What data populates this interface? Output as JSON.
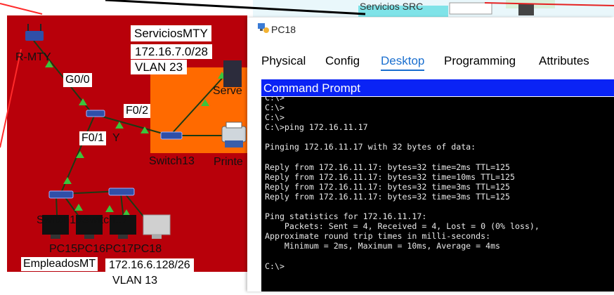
{
  "topology": {
    "labels": {
      "g0_0": "G0/0",
      "f0_2": "F0/2",
      "f0_1": "F0/1",
      "servicios_name": "ServiciosMTY",
      "servicios_net": "172.16.7.0/28",
      "servicios_vlan": "VLAN 23",
      "router": "R-MTY",
      "server": "Serve",
      "printer": "Printe",
      "switch13": "Switch13",
      "y_fragment": "Y",
      "pc_labels": "PC15PC16PC17PC18",
      "switch_labels": "Switch16Switch17",
      "empleados_name": "EmpleadosMT",
      "empleados_net": "172.16.6.128/26",
      "empleados_vlan": "VLAN 13",
      "top_fragment": "Servicios SRC"
    },
    "colors": {
      "empleados_area": "#b8000a",
      "servicios_area": "#ff6a00",
      "link": "#1b3a14",
      "link_up": "#3cc33c",
      "device_blue": "#2f4fa8"
    }
  },
  "window": {
    "title": "PC18",
    "icon": "pc-icon",
    "tabs": [
      "Physical",
      "Config",
      "Desktop",
      "Programming",
      "Attributes"
    ],
    "active_tab": "Desktop",
    "panel_title": "Command Prompt",
    "console_lines": [
      "C:\\>",
      "C:\\>",
      "C:\\>",
      "C:\\>ping 172.16.11.17",
      "",
      "Pinging 172.16.11.17 with 32 bytes of data:",
      "",
      "Reply from 172.16.11.17: bytes=32 time=2ms TTL=125",
      "Reply from 172.16.11.17: bytes=32 time=10ms TTL=125",
      "Reply from 172.16.11.17: bytes=32 time=3ms TTL=125",
      "Reply from 172.16.11.17: bytes=32 time=3ms TTL=125",
      "",
      "Ping statistics for 172.16.11.17:",
      "    Packets: Sent = 4, Received = 4, Lost = 0 (0% loss),",
      "Approximate round trip times in milli-seconds:",
      "    Minimum = 2ms, Maximum = 10ms, Average = 4ms",
      "",
      "C:\\>"
    ]
  }
}
